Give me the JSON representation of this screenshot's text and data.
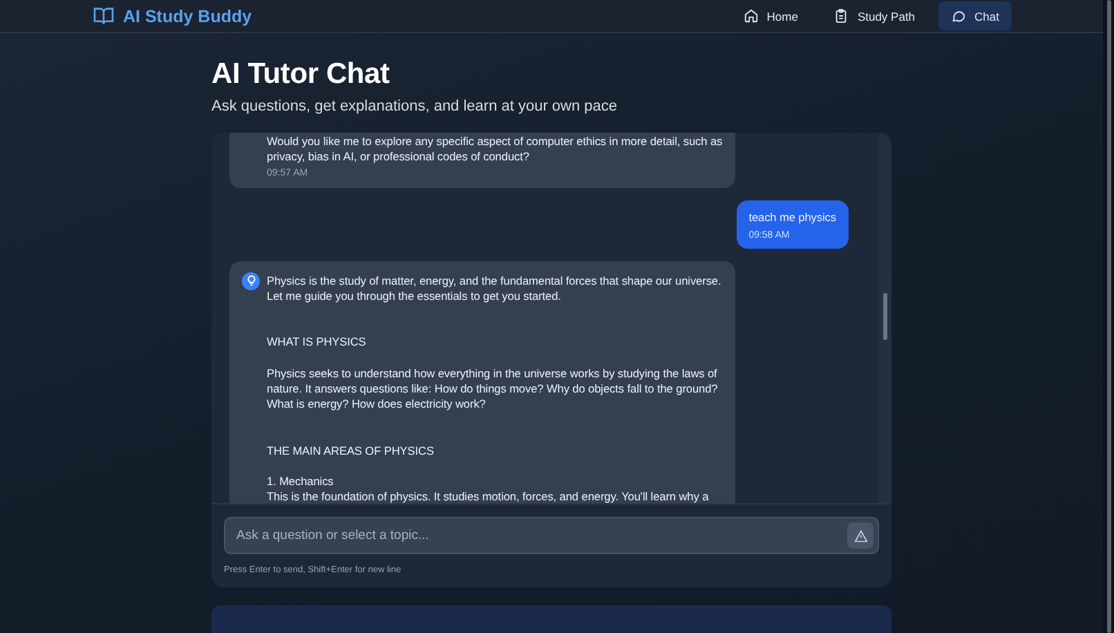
{
  "header": {
    "brand": "AI Study Buddy",
    "nav": [
      {
        "label": "Home",
        "selected": false
      },
      {
        "label": "Study Path",
        "selected": false
      },
      {
        "label": "Chat",
        "selected": true
      }
    ]
  },
  "page": {
    "title": "AI Tutor Chat",
    "subtitle": "Ask questions, get explanations, and learn at your own pace"
  },
  "messages": [
    {
      "kind": "assistant",
      "text": "Would you like me to explore any specific aspect of computer ethics in more detail, such as privacy, bias in AI, or professional codes of conduct?",
      "time": "09:57 AM",
      "icon": false
    },
    {
      "kind": "user",
      "text": "teach me physics",
      "time": "09:58 AM",
      "icon": false
    },
    {
      "kind": "assistant",
      "text": "Physics is the study of matter, energy, and the fundamental forces that shape our universe. Let me guide you through the essentials to get you started.\n\n\nWHAT IS PHYSICS\n\nPhysics seeks to understand how everything in the universe works by studying the laws of nature. It answers questions like: How do things move? Why do objects fall to the ground? What is energy? How does electricity work?\n\n\nTHE MAIN AREAS OF PHYSICS\n\n1. Mechanics\nThis is the foundation of physics. It studies motion, forces, and energy. You'll learn why a",
      "icon": true
    }
  ],
  "composer": {
    "placeholder": "Ask a question or select a topic...",
    "hint": "Press Enter to send, Shift+Enter for new line"
  }
}
